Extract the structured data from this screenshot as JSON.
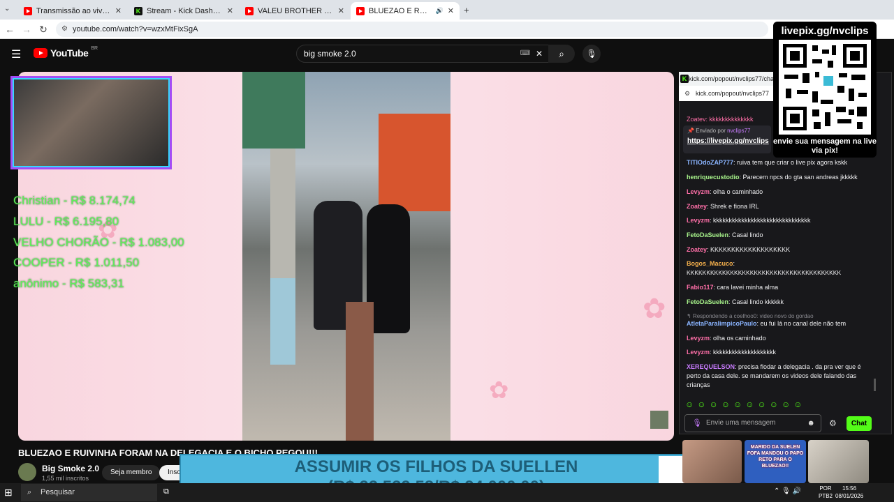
{
  "browser": {
    "tabs": [
      {
        "label": "Transmissão ao vivo - YouTube",
        "icon": "youtube-icon"
      },
      {
        "label": "Stream - Kick Dashboard",
        "icon": "kick-icon"
      },
      {
        "label": "VALEU BROTHER VOCÊ ME LIVR...",
        "icon": "youtube-icon"
      },
      {
        "label": "BLUEZAO E RUIVINHA FORA...",
        "icon": "youtube-icon"
      }
    ],
    "url": "youtube.com/watch?v=wzxMtFixSgA"
  },
  "youtube": {
    "logo": "YouTube",
    "logo_region": "BR",
    "search_value": "big smoke 2.0",
    "video_title": "BLUEZAO E RUIVINHA FORAM NA DELEGACIA E O BICHO PEGOU!!!",
    "channel_name": "Big Smoke 2.0",
    "subscribers": "1,55 mil inscritos",
    "join_label": "Seja membro",
    "subscribe_label": "Insc"
  },
  "overlay": {
    "donors": [
      "Christian - R$ 8.174,74",
      "LULU - R$ 6.195,80",
      "VELHO CHORÃO - R$ 1.083,00",
      "COOPER - R$ 1.011,50",
      "anônimo - R$ 583,31"
    ],
    "goal_line1": "ASSUMIR OS FILHOS DA SUELLEN",
    "goal_line2": "(R$ 22.539,58/R$ 24.000,00)",
    "goal_progress": 0.939
  },
  "qr": {
    "title": "livepix.gg/nvclips",
    "footer": "envie sua mensagem na live via pix!"
  },
  "chat": {
    "popup_tab": "kick.com/popout/nvclips77/chat",
    "popup_url": "kick.com/popout/nvclips77",
    "pinned_by": "Enviado por",
    "pinned_user": "nvclips77",
    "pinned_link": "https://livepix.gg/nvclips",
    "top_cut": "Zoatey: kkkkkkkkkkkkkk",
    "messages": [
      {
        "user": "TITIOdoZAP777",
        "color": "#8ab4ff",
        "text": "ruiva tem que criar o live pix agora kskk"
      },
      {
        "user": "henriquecustodio",
        "color": "#a9f58c",
        "text": "Parecem npcs do gta san andreas jkkkkk"
      },
      {
        "user": "Levyzm",
        "color": "#ff6fa8",
        "text": "olha o caminhado"
      },
      {
        "user": "Zoatey",
        "color": "#ff6fa8",
        "text": "Shrek e fiona IRL"
      },
      {
        "user": "Levyzm",
        "color": "#ff6fa8",
        "text": "kkkkkkkkkkkkkkkkkkkkkkkkkkkkkkk"
      },
      {
        "user": "FetoDaSuelen",
        "color": "#a9f58c",
        "text": "Casal lindo"
      },
      {
        "user": "Zoatey",
        "color": "#ff6fa8",
        "text": "KKKKKKKKKKKKKKKKKKK"
      },
      {
        "user": "Bogos_Macuco",
        "color": "#f5b04c",
        "text": "KKKKKKKKKKKKKKKKKKKKKKKKKKKKKKKKKKKKKKK"
      },
      {
        "user": "Fabio117",
        "color": "#ff6fa8",
        "text": "cara lavei minha alma"
      },
      {
        "user": "FetoDaSuelen",
        "color": "#a9f58c",
        "text": "Casal lindo kkkkkk"
      }
    ],
    "reply_note": "Respondendo a coelhoo0: video novo do gordao",
    "messages2": [
      {
        "user": "AtletaParalimpicoPaulo",
        "color": "#8ab4ff",
        "text": "eu fui lá no canal dele não tem"
      },
      {
        "user": "Levyzm",
        "color": "#ff6fa8",
        "text": "olha os caminhado"
      },
      {
        "user": "Levyzm",
        "color": "#ff6fa8",
        "text": "kkkkkkkkkkkkkkkkkkkk"
      },
      {
        "user": "XEREQUELSON",
        "color": "#c97cff",
        "text": "precisa flodar a delegacia . da pra ver que é perto da casa dele. se mandarem os videos dele falando das crianças"
      }
    ],
    "input_placeholder": "Envie uma mensagem",
    "send_label": "Chat"
  },
  "thumbs": {
    "text": "MARIDO DA SUELEN FOFA MANDOU O PAPO RETO PARA O BLUEZAO!!"
  },
  "taskbar": {
    "search_placeholder": "Pesquisar",
    "lang1": "POR",
    "lang2": "PTB2",
    "time": "15:56",
    "date": "08/01/2026"
  }
}
